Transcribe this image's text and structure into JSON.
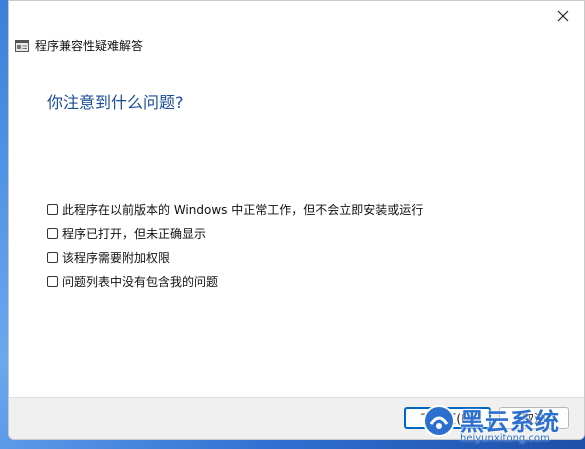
{
  "dialog": {
    "title": "程序兼容性疑难解答",
    "heading": "你注意到什么问题?",
    "options": [
      {
        "label": "此程序在以前版本的 Windows 中正常工作，但不会立即安装或运行",
        "checked": false
      },
      {
        "label": "程序已打开，但未正确显示",
        "checked": false
      },
      {
        "label": "该程序需要附加权限",
        "checked": false
      },
      {
        "label": "问题列表中没有包含我的问题",
        "checked": false
      }
    ],
    "buttons": {
      "next": "下一页(N)",
      "cancel": "取消"
    },
    "icons": {
      "close": "close-icon",
      "app": "compatibility-troubleshooter-icon"
    }
  },
  "watermark": {
    "brand": "黑云系统",
    "url": "heiyunxitong.com"
  },
  "colors": {
    "heading": "#1a4c99",
    "accent": "#0067c0",
    "watermark": "#2d6fcf"
  }
}
